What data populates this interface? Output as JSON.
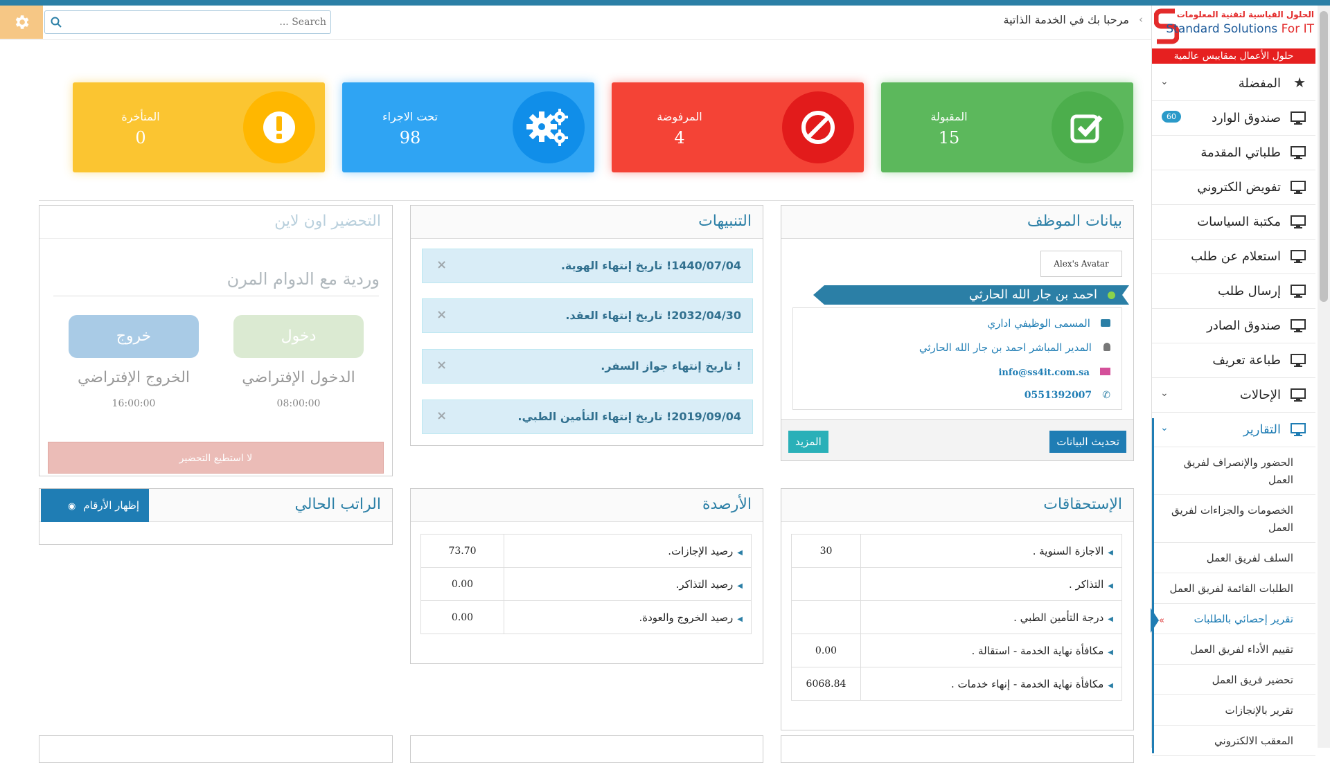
{
  "header": {
    "welcome": "مرحبا بك في الخدمة الذاتية",
    "search_placeholder": "Search ...",
    "gear": "gear-icon"
  },
  "logo": {
    "line1": "الحلول القياسية لتقنية المعلومات",
    "line2_a": "Standard Solutions",
    "line2_b": " For IT",
    "band": "حلول الأعمال بمقاييس عالمية"
  },
  "sidebar": {
    "items": [
      {
        "label": "المفضلة",
        "icon": "star-icon",
        "caret": "⌄"
      },
      {
        "label": "صندوق الوارد",
        "icon": "monitor-icon",
        "badge": "60"
      },
      {
        "label": "طلباتي المقدمة",
        "icon": "monitor-icon"
      },
      {
        "label": "تفويض الكتروني",
        "icon": "monitor-icon"
      },
      {
        "label": "مكتبة السياسات",
        "icon": "monitor-icon"
      },
      {
        "label": "استعلام عن طلب",
        "icon": "monitor-icon"
      },
      {
        "label": "إرسال طلب",
        "icon": "monitor-icon"
      },
      {
        "label": "صندوق الصادر",
        "icon": "monitor-icon"
      },
      {
        "label": "طباعة تعريف",
        "icon": "monitor-icon"
      },
      {
        "label": "الإحالات",
        "icon": "monitor-icon",
        "caret": "⌄"
      },
      {
        "label": "التقارير",
        "icon": "monitor-icon",
        "caret": "⌄"
      }
    ],
    "subitems": [
      "الحضور والإنصراف لفريق العمل",
      "الخصومات والجزاءات لفريق العمل",
      "السلف لفريق العمل",
      "الطلبات القائمة لفريق العمل",
      "تقرير إحصائي بالطلبات",
      "تقييم الأداء لفريق العمل",
      "تحضير فريق العمل",
      "تقرير بالإنجازات",
      "المعقب الالكتروني"
    ],
    "active_mark": "»"
  },
  "stats": [
    {
      "title": "المقبولة",
      "value": "15",
      "color": "#5cb85c",
      "circle": "#4cae4c",
      "icon": "check-icon"
    },
    {
      "title": "المرفوضة",
      "value": "4",
      "color": "#f44336",
      "circle": "#e21b1b",
      "icon": "ban-icon"
    },
    {
      "title": "تحت الاجراء",
      "value": "98",
      "color": "#2fa4f3",
      "circle": "#108ee9",
      "icon": "gears-icon"
    },
    {
      "title": "المتأخرة",
      "value": "0",
      "color": "#fbc531",
      "circle": "#ffb700",
      "icon": "exclamation-icon"
    }
  ],
  "employee": {
    "title": "بيانات الموظف",
    "avatar_alt": "Alex's Avatar",
    "name": "احمد بن جار الله الحارثي",
    "job": "المسمى الوظيفي اداري",
    "manager": "المدير المباشر احمد بن جار الله الحارثي",
    "email": "info@ss4it.com.sa",
    "phone": "0551392007",
    "update_btn": "تحديث البيانات",
    "more_btn": "المزيد"
  },
  "alerts": {
    "title": "التنبيهات",
    "items": [
      "1440/07/04! تاريخ إنتهاء الهوية.",
      "2032/04/30! تاريخ إنتهاء العقد.",
      "! تاريخ إنتهاء جواز السفر.",
      "2019/09/04! تاريخ إنتهاء التأمين الطبي."
    ],
    "close": "×"
  },
  "attendance": {
    "title": "التحضير اون لاين",
    "shift": "وردية مع الدوام المرن",
    "in_btn": "دخول",
    "out_btn": "خروج",
    "in_label": "الدخول الإفتراضي",
    "out_label": "الخروج الإفتراضي",
    "in_time": "08:00:00",
    "out_time": "16:00:00",
    "cannot": "لا استطيع التحضير"
  },
  "entitlements": {
    "title": "الإستحقاقات",
    "rows": [
      {
        "k": "الاجازة السنوية .",
        "v": "30"
      },
      {
        "k": "التذاكر .",
        "v": ""
      },
      {
        "k": "درجة التأمين الطبي .",
        "v": ""
      },
      {
        "k": "مكافأة نهاية الخدمة - استقالة .",
        "v": "0.00"
      },
      {
        "k": "مكافأة نهاية الخدمة - إنهاء خدمات .",
        "v": "6068.84"
      }
    ]
  },
  "balances": {
    "title": "الأرصدة",
    "rows": [
      {
        "k": "رصيد الإجازات.",
        "v": "73.70"
      },
      {
        "k": "رصيد التذاكر.",
        "v": "0.00"
      },
      {
        "k": "رصيد الخروج والعودة.",
        "v": "0.00"
      }
    ]
  },
  "salary": {
    "title": "الراتب الحالي",
    "show_btn": "إظهار الأرقام"
  }
}
